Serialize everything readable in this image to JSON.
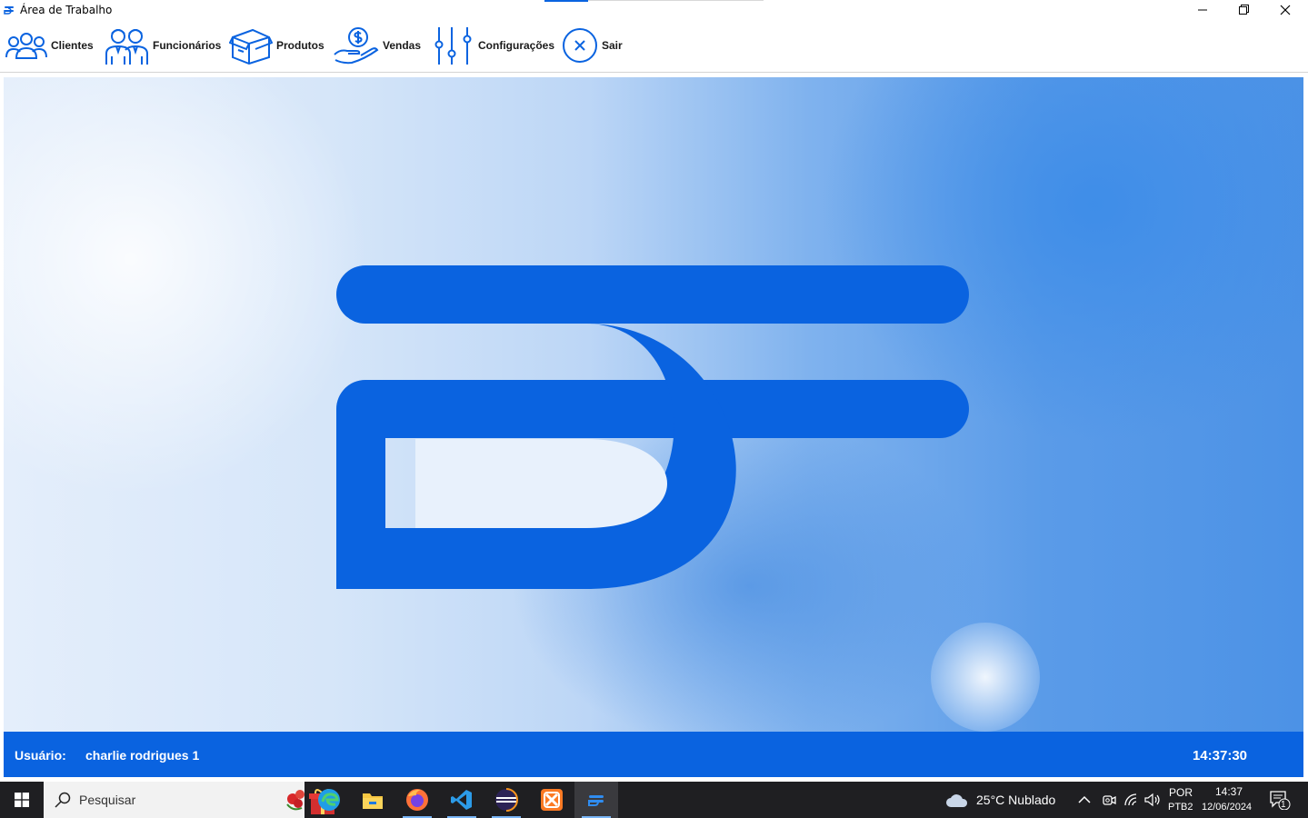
{
  "window": {
    "title": "Área de Trabalho",
    "minimize_icon": "minimize-icon",
    "maximize_icon": "restore-icon",
    "close_icon": "close-icon"
  },
  "menu": {
    "items": [
      {
        "label": "Clientes",
        "icon": "users-group-icon"
      },
      {
        "label": "Funcionários",
        "icon": "employees-icon"
      },
      {
        "label": "Produtos",
        "icon": "box-icon"
      },
      {
        "label": "Vendas",
        "icon": "money-hand-icon"
      },
      {
        "label": "Configurações",
        "icon": "sliders-icon"
      },
      {
        "label": "Sair",
        "icon": "exit-circle-icon"
      }
    ]
  },
  "status": {
    "user_label": "Usuário:",
    "user_name": "charlie rodrigues 1",
    "time": "14:37:30"
  },
  "taskbar": {
    "search_placeholder": "Pesquisar",
    "apps": [
      "edge-icon",
      "file-explorer-icon",
      "firefox-icon",
      "vscode-icon",
      "eclipse-icon",
      "xampp-icon",
      "app-logo-icon"
    ],
    "weather": "25°C  Nublado",
    "language_top": "POR",
    "language_bottom": "PTB2",
    "clock_time": "14:37",
    "clock_date": "12/06/2024",
    "notification_count": "1"
  },
  "colors": {
    "brand_blue": "#0a63e0",
    "logo_blue": "#0a63e0"
  }
}
